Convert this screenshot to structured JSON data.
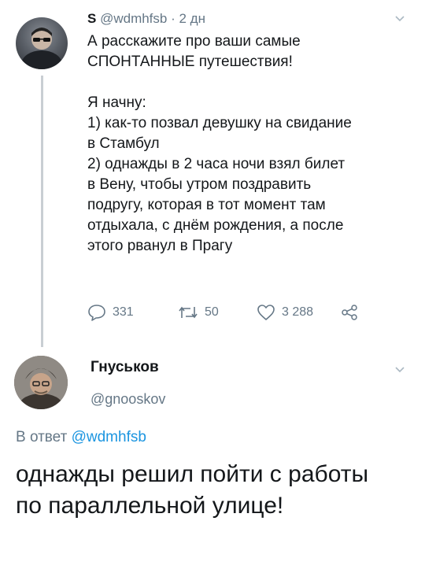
{
  "tweet1": {
    "name": "S",
    "handle": "@wdmhfsb",
    "time": "· 2 дн",
    "intro": "А расскажите про ваши самые\nСПОНТАННЫЕ путешествия!",
    "body": "Я начну:\n1) как-то позвал девушку на свидание\nв Стамбул\n2) однажды в 2 часа ночи взял билет\nв Вену, чтобы утром поздравить\nподругу, которая в тот момент там\nотдыхала, с днём рождения, а после\nэтого рванул в Прагу",
    "replies": "331",
    "retweets": "50",
    "likes": "3 288"
  },
  "tweet2": {
    "name": "Гнуськов",
    "handle": "@gnooskov",
    "reply_prefix": "В ответ",
    "reply_to": "@wdmhfsb",
    "text": "однажды решил пойти с работы\nпо параллельной улице!"
  },
  "colors": {
    "text": "#14171a",
    "muted": "#657786",
    "link": "#1b95e0",
    "thread_line": "#c9ced3"
  },
  "icons": [
    "reply-icon",
    "retweet-icon",
    "like-icon",
    "share-icon",
    "chevron-down-icon"
  ]
}
